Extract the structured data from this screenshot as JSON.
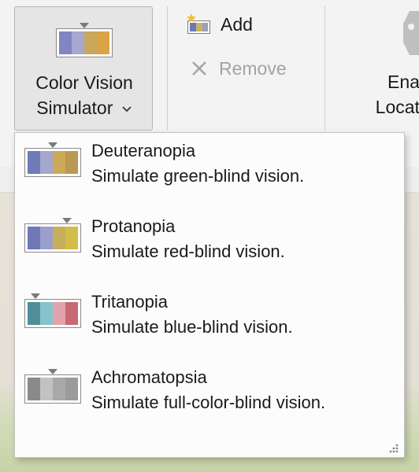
{
  "ribbon": {
    "color_vision_button": {
      "line1": "Color Vision",
      "line2": "Simulator",
      "chevron": "chevron-down-icon"
    },
    "add_label": "Add",
    "remove_label": "Remove",
    "enable_locator_line1": "Ena",
    "enable_locator_line2": "Locat"
  },
  "menu": {
    "items": [
      {
        "title": "Deuteranopia",
        "description": "Simulate green-blind vision.",
        "icon": "deuteranopia-palette-icon"
      },
      {
        "title": "Protanopia",
        "description": "Simulate red-blind vision.",
        "icon": "protanopia-palette-icon"
      },
      {
        "title": "Tritanopia",
        "description": "Simulate blue-blind vision.",
        "icon": "tritanopia-palette-icon"
      },
      {
        "title": "Achromatopsia",
        "description": "Simulate full-color-blind vision.",
        "icon": "achromatopsia-palette-icon"
      }
    ]
  }
}
